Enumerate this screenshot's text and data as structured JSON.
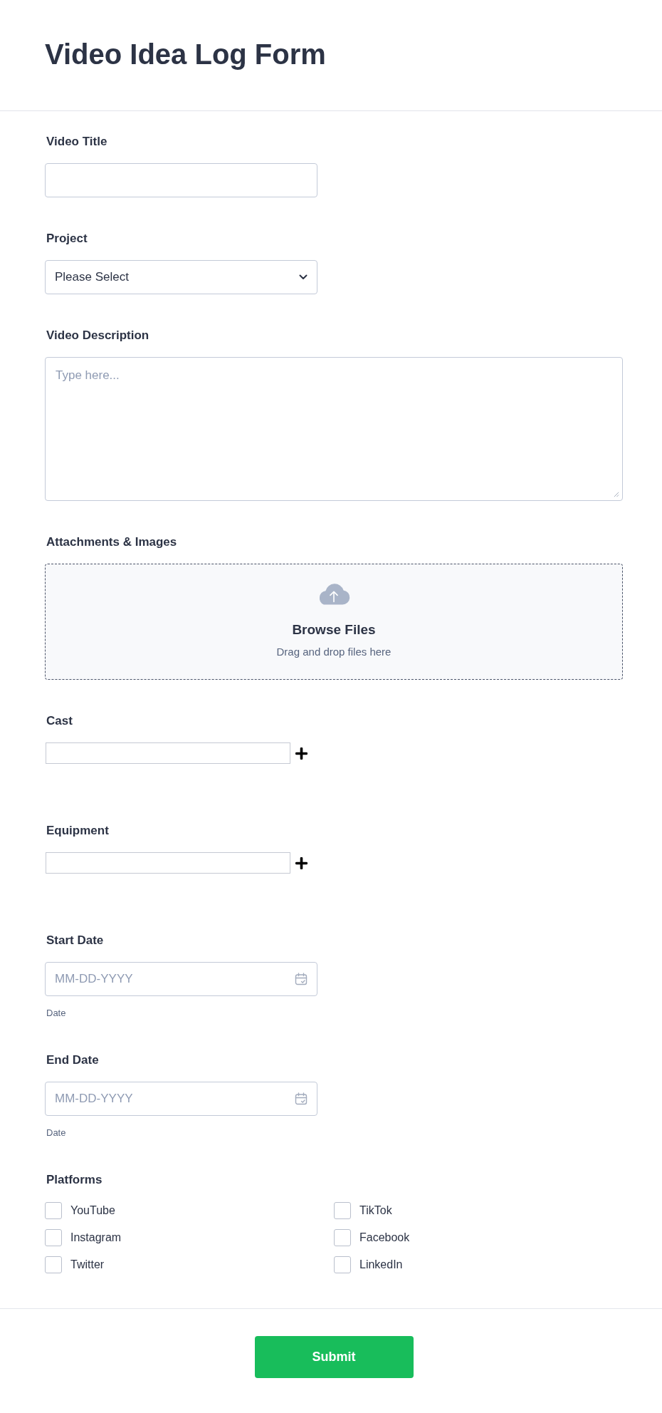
{
  "header": {
    "title": "Video Idea Log Form"
  },
  "fields": [
    {
      "kind": "text",
      "label": "Video Title"
    },
    {
      "kind": "select",
      "label": "Project",
      "value": "Please Select"
    },
    {
      "kind": "textarea",
      "label": "Video Description",
      "placeholder": "Type here..."
    },
    {
      "kind": "upload",
      "label": "Attachments & Images",
      "button_text": "Browse Files",
      "hint": "Drag and drop files here"
    },
    {
      "kind": "list",
      "label": "Cast"
    },
    {
      "kind": "list",
      "label": "Equipment"
    },
    {
      "kind": "date",
      "label": "Start Date",
      "placeholder": "MM-DD-YYYY",
      "sublabel": "Date"
    },
    {
      "kind": "date",
      "label": "End Date",
      "placeholder": "MM-DD-YYYY",
      "sublabel": "Date"
    },
    {
      "kind": "checkboxes",
      "label": "Platforms",
      "options": [
        {
          "label": "YouTube",
          "checked": false
        },
        {
          "label": "TikTok",
          "checked": false
        },
        {
          "label": "Instagram",
          "checked": false
        },
        {
          "label": "Facebook",
          "checked": false
        },
        {
          "label": "Twitter",
          "checked": false
        },
        {
          "label": "LinkedIn",
          "checked": false
        }
      ]
    }
  ],
  "submit": {
    "label": "Submit"
  }
}
